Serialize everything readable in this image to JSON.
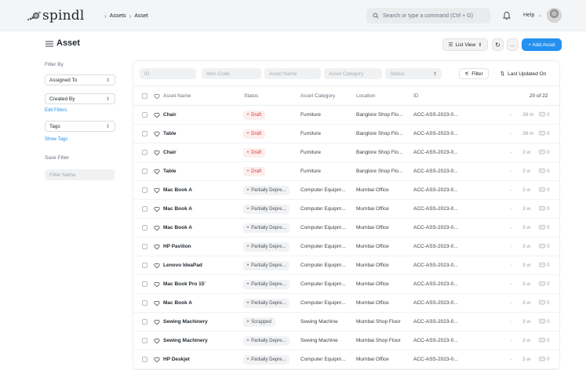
{
  "app": {
    "logo_text": "spindl",
    "breadcrumbs": [
      "Assets",
      "Asset"
    ],
    "search_placeholder": "Search or type a command (Ctrl + G)",
    "help_label": "Help"
  },
  "page": {
    "title": "Asset",
    "list_view_label": "List View",
    "more_label": "...",
    "add_label": "+ Add Asset"
  },
  "sidebar": {
    "filter_by": "Filter By",
    "assigned_to": "Assigned To",
    "created_by": "Created By",
    "edit_filters": "Edit Filters",
    "tags": "Tags",
    "show_tags": "Show Tags",
    "save_filter": "Save Filter",
    "filter_name_placeholder": "Filter Name"
  },
  "filters": {
    "id": "ID",
    "item_code": "Item Code",
    "asset_name": "Asset Name",
    "asset_category": "Asset Category",
    "status": "Status",
    "filter_btn": "Filter",
    "sort_btn": "Last Updated On"
  },
  "table": {
    "headers": {
      "asset_name": "Asset Name",
      "status": "Status",
      "asset_category": "Asset Category",
      "location": "Location",
      "id": "ID",
      "count": "20 of 22"
    },
    "rows": [
      {
        "name": "Chair",
        "status": "Draft",
        "status_type": "draft",
        "category": "Furniture",
        "location": "Banglore Shop Flo...",
        "id": "ACC-ASS-2023-0...",
        "dash": "-",
        "time": "38 m",
        "comments": "0"
      },
      {
        "name": "Table",
        "status": "Draft",
        "status_type": "draft",
        "category": "Furniture",
        "location": "Banglore Shop Flo...",
        "id": "ACC-ASS-2023-0...",
        "dash": "-",
        "time": "38 m",
        "comments": "0"
      },
      {
        "name": "Chair",
        "status": "Draft",
        "status_type": "draft",
        "category": "Furniture",
        "location": "Banglore Shop Flo...",
        "id": "ACC-ASS-2023-0...",
        "dash": "-",
        "time": "3 w",
        "comments": "0"
      },
      {
        "name": "Table",
        "status": "Draft",
        "status_type": "draft",
        "category": "Furniture",
        "location": "Banglore Shop Flo...",
        "id": "ACC-ASS-2023-0...",
        "dash": "-",
        "time": "3 w",
        "comments": "0"
      },
      {
        "name": "Mac Book A",
        "status": "Partially Depre...",
        "status_type": "partial",
        "category": "Computer Equipm...",
        "location": "Mumbai Office",
        "id": "ACC-ASS-2023-0...",
        "dash": "-",
        "time": "3 w",
        "comments": "0"
      },
      {
        "name": "Mac Book A",
        "status": "Partially Depre...",
        "status_type": "partial",
        "category": "Computer Equipm...",
        "location": "Mumbai Office",
        "id": "ACC-ASS-2023-0...",
        "dash": "-",
        "time": "3 w",
        "comments": "0"
      },
      {
        "name": "Mac Book A",
        "status": "Partially Depre...",
        "status_type": "partial",
        "category": "Computer Equipm...",
        "location": "Mumbai Office",
        "id": "ACC-ASS-2023-0...",
        "dash": "-",
        "time": "3 w",
        "comments": "0"
      },
      {
        "name": "HP Pavilion",
        "status": "Partially Depre...",
        "status_type": "partial",
        "category": "Computer Equipm...",
        "location": "Mumbai Office",
        "id": "ACC-ASS-2023-0...",
        "dash": "-",
        "time": "3 w",
        "comments": "0"
      },
      {
        "name": "Lenovo IdeaPad",
        "status": "Partially Depre...",
        "status_type": "partial",
        "category": "Computer Equipm...",
        "location": "Mumbai Office",
        "id": "ACC-ASS-2023-0...",
        "dash": "-",
        "time": "3 w",
        "comments": "0"
      },
      {
        "name": "Mac Book Pro 15'",
        "status": "Partially Depre...",
        "status_type": "partial",
        "category": "Computer Equipm...",
        "location": "Mumbai Office",
        "id": "ACC-ASS-2023-0...",
        "dash": "-",
        "time": "3 w",
        "comments": "0"
      },
      {
        "name": "Mac Book A",
        "status": "Partially Depre...",
        "status_type": "partial",
        "category": "Computer Equipm...",
        "location": "Mumbai Office",
        "id": "ACC-ASS-2023-0...",
        "dash": "-",
        "time": "3 w",
        "comments": "0"
      },
      {
        "name": "Sewing Machinery",
        "status": "Scrapped",
        "status_type": "scrapped",
        "category": "Sewing Machine",
        "location": "Mumbai Shop Floor",
        "id": "ACC-ASS-2023-0...",
        "dash": "-",
        "time": "3 w",
        "comments": "0"
      },
      {
        "name": "Sewing Machinery",
        "status": "Partially Depre...",
        "status_type": "partial",
        "category": "Sewing Machine",
        "location": "Mumbai Shop Floor",
        "id": "ACC-ASS-2023-0...",
        "dash": "-",
        "time": "3 w",
        "comments": "0"
      },
      {
        "name": "HP Deskjet",
        "status": "Partially Depre...",
        "status_type": "partial",
        "category": "Computer Equipm...",
        "location": "Mumbai Office",
        "id": "ACC-ASS-2023-0...",
        "dash": "-",
        "time": "3 w",
        "comments": "0"
      }
    ]
  },
  "colors": {
    "primary": "#2490ef",
    "draft_text": "#e03636",
    "draft_bg": "#fdeeee"
  }
}
